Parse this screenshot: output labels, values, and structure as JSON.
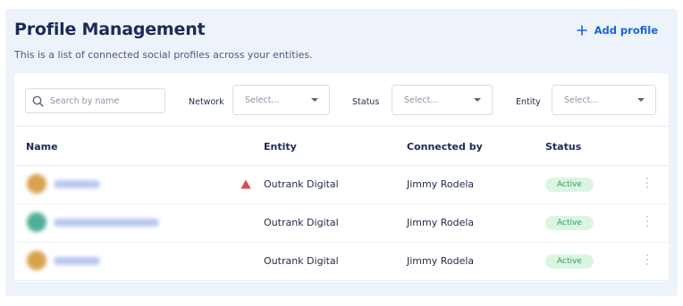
{
  "header": {
    "title": "Profile Management",
    "subtitle": "This is a list of connected social profiles across your entities.",
    "add_label": "Add profile"
  },
  "filters": {
    "search_placeholder": "Search by name",
    "network_label": "Network",
    "network_value": "Select...",
    "status_label": "Status",
    "status_value": "Select...",
    "entity_label": "Entity",
    "entity_value": "Select..."
  },
  "table": {
    "columns": [
      "Name",
      "Entity",
      "Connected by",
      "Status"
    ],
    "rows": [
      {
        "entity": "Outrank Digital",
        "connected_by": "Jimmy Rodela",
        "status": "Active",
        "warning": true,
        "avatar_color": "#d9a24e"
      },
      {
        "entity": "Outrank Digital",
        "connected_by": "Jimmy Rodela",
        "status": "Active",
        "warning": false,
        "avatar_color": "#4fae9a"
      },
      {
        "entity": "Outrank Digital",
        "connected_by": "Jimmy Rodela",
        "status": "Active",
        "warning": false,
        "avatar_color": "#d9a24e"
      }
    ]
  },
  "colors": {
    "accent": "#1764d8",
    "active_badge_bg": "#dcf5e3",
    "active_badge_text": "#2f9a59",
    "warning": "#e04848"
  },
  "icons": [
    "plus-icon",
    "search-icon",
    "chevron-down-icon",
    "warning-icon",
    "more-vertical-icon"
  ]
}
